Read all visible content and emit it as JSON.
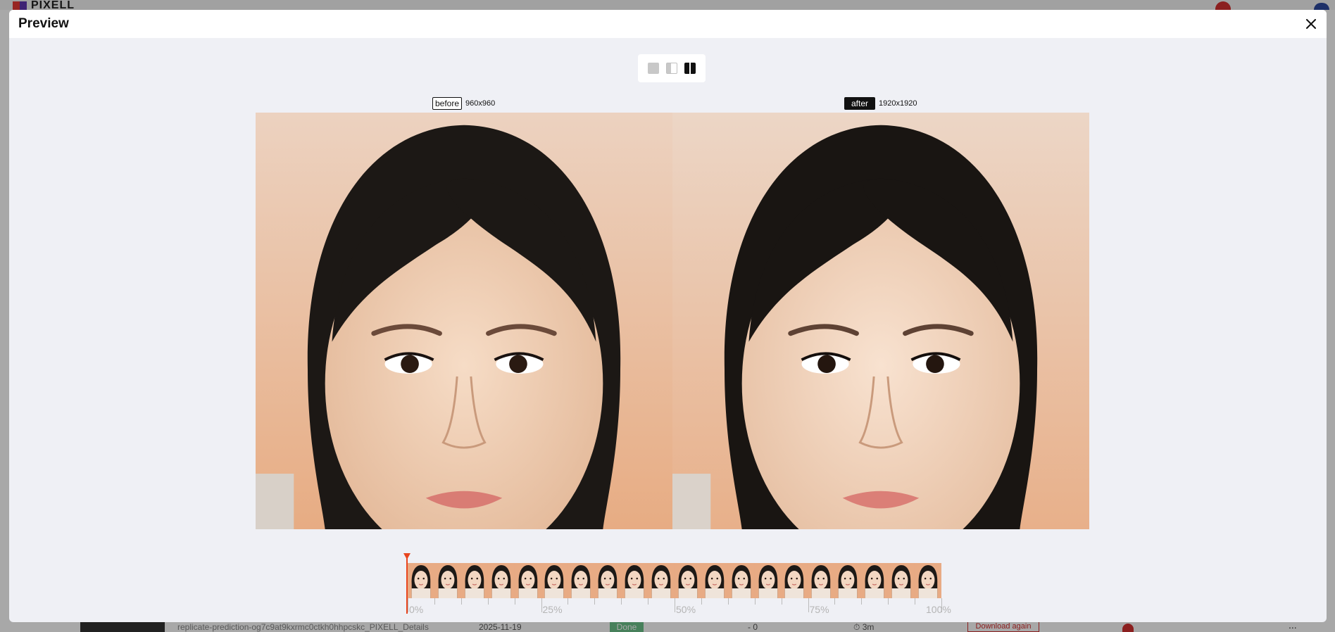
{
  "background_app": {
    "logo_text": "PIXELL",
    "row": {
      "id_text": "replicate-prediction-og7c9at9kxrmc0ctkh0hhpcskc_PIXELL_Details",
      "date": "2025-11-19",
      "status": "Done",
      "count": "- 0",
      "duration": "⏱ 3m",
      "download_label": "Download again",
      "more": "..."
    }
  },
  "modal": {
    "title": "Preview",
    "close_icon": "close-icon"
  },
  "view_modes": [
    {
      "name": "single",
      "icon": "single-view-icon",
      "active": false
    },
    {
      "name": "slider",
      "icon": "slider-view-icon",
      "active": false
    },
    {
      "name": "side-by-side",
      "icon": "side-by-side-icon",
      "active": true
    }
  ],
  "before": {
    "tag": "before",
    "resolution": "960x960"
  },
  "after": {
    "tag": "after",
    "resolution": "1920x1920"
  },
  "timeline": {
    "playhead_position": 0,
    "frame_count": 20,
    "labels": [
      "0%",
      "25%",
      "50%",
      "75%",
      "100%"
    ]
  },
  "colors": {
    "playhead": "#e8451e",
    "modal_bg": "#eff0f5",
    "active_tag_bg": "#111111"
  }
}
